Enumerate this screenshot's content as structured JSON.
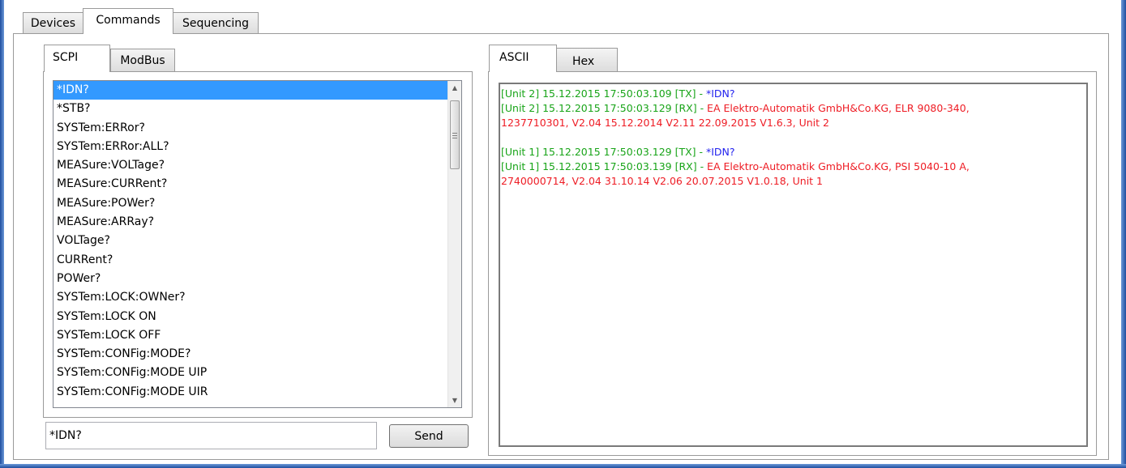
{
  "main_tabs": [
    {
      "label": "Devices",
      "active": false
    },
    {
      "label": "Commands",
      "active": true
    },
    {
      "label": "Sequencing",
      "active": false
    }
  ],
  "left_panel": {
    "tabs": [
      {
        "label": "SCPI",
        "active": true
      },
      {
        "label": "ModBus",
        "active": false
      }
    ],
    "commands": [
      "*IDN?",
      "*STB?",
      "SYSTem:ERRor?",
      "SYSTem:ERRor:ALL?",
      "MEASure:VOLTage?",
      "MEASure:CURRent?",
      "MEASure:POWer?",
      "MEASure:ARRay?",
      "VOLTage?",
      "CURRent?",
      "POWer?",
      "SYSTem:LOCK:OWNer?",
      "SYSTem:LOCK ON",
      "SYSTem:LOCK OFF",
      "SYSTem:CONFig:MODE?",
      "SYSTem:CONFig:MODE UIP",
      "SYSTem:CONFig:MODE UIR"
    ],
    "selected_index": 0,
    "command_input_value": "*IDN?",
    "send_label": "Send"
  },
  "right_panel": {
    "tabs": [
      {
        "label": "ASCII",
        "active": true
      },
      {
        "label": "Hex",
        "active": false
      }
    ],
    "log": [
      {
        "meta": "[Unit 2] 15.12.2015  17:50:03.109  [TX] - ",
        "text": "*IDN?",
        "kind": "tx"
      },
      {
        "meta": "[Unit 2] 15.12.2015  17:50:03.129  [RX] - ",
        "text": "EA Elektro-Automatik GmbH&Co.KG, ELR 9080-340,",
        "kind": "rx"
      },
      {
        "meta": "",
        "text": "1237710301, V2.04 15.12.2014 V2.11 22.09.2015 V1.6.3, Unit 2",
        "kind": "rx"
      },
      {
        "meta": "",
        "text": "",
        "kind": "blank"
      },
      {
        "meta": "[Unit 1] 15.12.2015  17:50:03.129  [TX] - ",
        "text": "*IDN?",
        "kind": "tx"
      },
      {
        "meta": "[Unit 1] 15.12.2015  17:50:03.139  [RX] - ",
        "text": "EA Elektro-Automatik GmbH&Co.KG, PSI 5040-10 A,",
        "kind": "rx"
      },
      {
        "meta": "",
        "text": "2740000714, V2.04 31.10.14 V2.06 20.07.2015 V1.0.18, Unit 1",
        "kind": "rx"
      }
    ]
  },
  "colors": {
    "meta": "#18a418",
    "tx": "#2222ee",
    "rx": "#ee1c24",
    "selection": "#3399ff",
    "window_frame": "#1f4e9e"
  }
}
